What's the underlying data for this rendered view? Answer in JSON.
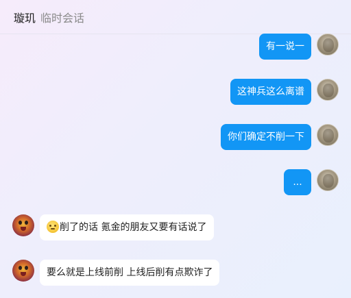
{
  "header": {
    "name": "璇玑",
    "subtitle": "临时会话"
  },
  "messages": [
    {
      "sender": "me",
      "avatar_icon": "user-avatar-icon",
      "text": "有一说一"
    },
    {
      "sender": "me",
      "avatar_icon": "user-avatar-icon",
      "text": "这神兵这么离谱"
    },
    {
      "sender": "me",
      "avatar_icon": "user-avatar-icon",
      "text": "你们确定不削一下"
    },
    {
      "sender": "me",
      "avatar_icon": "user-avatar-icon",
      "text": "..."
    },
    {
      "sender": "other",
      "avatar_icon": "contact-avatar-icon",
      "emoji_icon": "slight-smile-emoji-icon",
      "text": "削了的话 氪金的朋友又要有话说了"
    },
    {
      "sender": "other",
      "avatar_icon": "contact-avatar-icon",
      "text": "要么就是上线前削 上线后削有点欺诈了"
    }
  ],
  "colors": {
    "my_bubble": "#1296f5",
    "other_bubble": "#ffffff"
  }
}
